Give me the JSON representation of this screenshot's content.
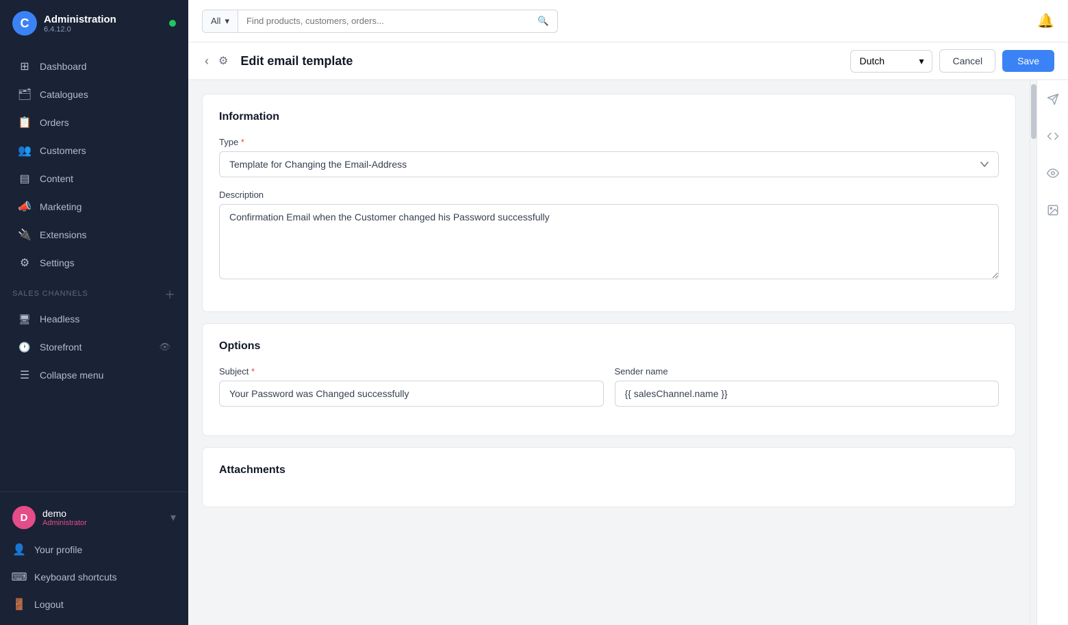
{
  "sidebar": {
    "app_title": "Administration",
    "app_version": "6.4.12.0",
    "online_status": "online",
    "nav_items": [
      {
        "id": "dashboard",
        "label": "Dashboard",
        "icon": "⊞"
      },
      {
        "id": "catalogues",
        "label": "Catalogues",
        "icon": "🗂"
      },
      {
        "id": "orders",
        "label": "Orders",
        "icon": "📋"
      },
      {
        "id": "customers",
        "label": "Customers",
        "icon": "👥"
      },
      {
        "id": "content",
        "label": "Content",
        "icon": "▤"
      },
      {
        "id": "marketing",
        "label": "Marketing",
        "icon": "📣"
      },
      {
        "id": "extensions",
        "label": "Extensions",
        "icon": "🔌"
      },
      {
        "id": "settings",
        "label": "Settings",
        "icon": "⚙"
      }
    ],
    "sales_channels_label": "Sales Channels",
    "sales_channels": [
      {
        "id": "headless",
        "label": "Headless",
        "icon": "🖥"
      },
      {
        "id": "storefront",
        "label": "Storefront",
        "icon": "🕐",
        "has_eye": true
      }
    ],
    "collapse_label": "Collapse menu",
    "user": {
      "initial": "D",
      "name": "demo",
      "role": "Administrator"
    },
    "bottom_items": [
      {
        "id": "your-profile",
        "label": "Your profile",
        "icon": "👤"
      },
      {
        "id": "keyboard-shortcuts",
        "label": "Keyboard shortcuts",
        "icon": "⌨"
      },
      {
        "id": "logout",
        "label": "Logout",
        "icon": "🚪"
      }
    ]
  },
  "topbar": {
    "search_filter_label": "All",
    "search_placeholder": "Find products, customers, orders..."
  },
  "page_header": {
    "title": "Edit email template",
    "language": "Dutch",
    "cancel_label": "Cancel",
    "save_label": "Save"
  },
  "information_section": {
    "title": "Information",
    "type_label": "Type",
    "type_required": true,
    "type_value": "Template for Changing the Email-Address",
    "description_label": "Description",
    "description_value": "Confirmation Email when the Customer changed his Password successfully"
  },
  "options_section": {
    "title": "Options",
    "subject_label": "Subject",
    "subject_required": true,
    "subject_value": "Your Password was Changed successfully",
    "sender_name_label": "Sender name",
    "sender_name_value": "{{ salesChannel.name }}"
  },
  "attachments_section": {
    "title": "Attachments"
  },
  "right_toolbar": {
    "send_icon": "send",
    "code_icon": "code",
    "eye_icon": "eye",
    "image_icon": "image"
  }
}
